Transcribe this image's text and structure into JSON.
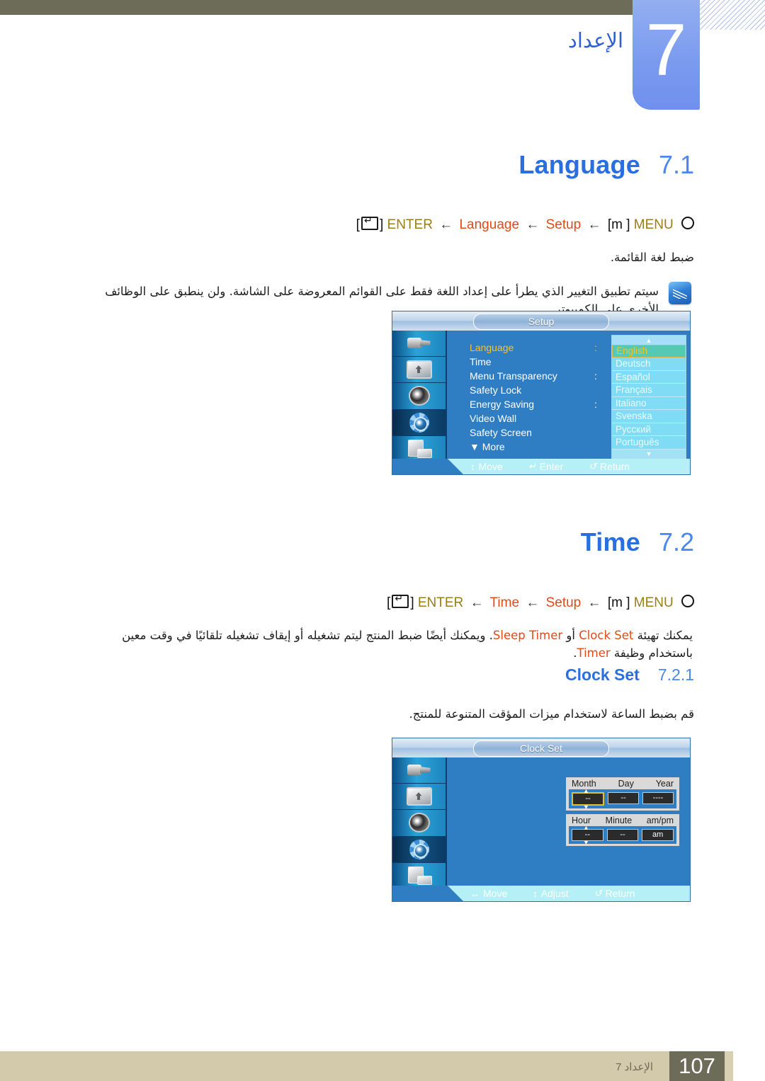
{
  "header": {
    "chapter_number": "7",
    "chapter_title": "الإعداد"
  },
  "sections": [
    {
      "title": "Language",
      "number": "7.1",
      "breadcrumb": {
        "enter_label": "ENTER",
        "item": "Language",
        "parent": "Setup",
        "menu_bracket": "[m  ]",
        "menu_label": "MENU",
        "arrow": "←"
      },
      "description_ar": "ضبط لغة القائمة.",
      "note_ar": "سيتم تطبيق التغيير الذي يطرأ على إعداد اللغة فقط على القوائم المعروضة على الشاشة. ولن ينطبق على الوظائف الأخرى على الكمبيوتر."
    },
    {
      "title": "Time",
      "number": "7.2",
      "breadcrumb": {
        "enter_label": "ENTER",
        "item": "Time",
        "parent": "Setup",
        "menu_bracket": "[m  ]",
        "menu_label": "MENU",
        "arrow": "←"
      },
      "description_ar_prefix": "يمكنك تهيئة ",
      "description_ar_middle": " أو ",
      "description_ar_rest": ". ويمكنك أيضًا ضبط المنتج ليتم تشغيله أو إيقاف تشغيله تلقائيًا في وقت معين باستخدام وظيفة ",
      "description_ar_suffix": ".",
      "red_term_1": "Clock Set",
      "red_term_2": "Sleep Timer",
      "red_term_3": "Timer"
    }
  ],
  "subsection": {
    "title": "Clock Set",
    "number": "7.2.1",
    "description_ar": "قم بضبط الساعة لاستخدام ميزات المؤقت المتنوعة للمنتج."
  },
  "osd_setup": {
    "title": "Setup",
    "sidebar_icons": [
      "input-plug-icon",
      "picture-icon",
      "sound-icon",
      "setup-gear-icon",
      "multi-control-icon"
    ],
    "selected_sidebar_index": 3,
    "menu_items": [
      {
        "label": "Language",
        "colon": ":",
        "active": true
      },
      {
        "label": "Time",
        "colon": "",
        "active": false
      },
      {
        "label": "Menu Transparency",
        "colon": ":",
        "active": false
      },
      {
        "label": "Safety Lock",
        "colon": "",
        "active": false
      },
      {
        "label": "Energy Saving",
        "colon": ":",
        "active": false
      },
      {
        "label": "Video Wall",
        "colon": "",
        "active": false
      },
      {
        "label": "Safety Screen",
        "colon": "",
        "active": false
      },
      {
        "label": "▼ More",
        "colon": "",
        "active": false
      }
    ],
    "language_options": [
      "English",
      "Deutsch",
      "Español",
      "Français",
      "Italiano",
      "Svenska",
      "Русский",
      "Português"
    ],
    "language_selected": "English",
    "scroll_up_glyph": "▲",
    "scroll_down_glyph": "▼",
    "hints": [
      {
        "glyph": "↕",
        "label": "Move"
      },
      {
        "glyph": "↵",
        "label": "Enter"
      },
      {
        "glyph": "↺",
        "label": "Return"
      }
    ]
  },
  "osd_clock": {
    "title": "Clock Set",
    "sidebar_icons": [
      "input-plug-icon",
      "picture-icon",
      "sound-icon",
      "setup-gear-icon",
      "multi-control-icon"
    ],
    "selected_sidebar_index": 3,
    "date_labels": [
      "Month",
      "Day",
      "Year"
    ],
    "date_values": [
      "--",
      "--",
      "----"
    ],
    "date_selected_index": 0,
    "time_labels": [
      "Hour",
      "Minute",
      "am/pm"
    ],
    "time_values": [
      "--",
      "--",
      "am"
    ],
    "hints": [
      {
        "glyph": "↔",
        "label": "Move"
      },
      {
        "glyph": "↕",
        "label": "Adjust"
      },
      {
        "glyph": "↺",
        "label": "Return"
      }
    ]
  },
  "footer": {
    "section_label": "الإعداد 7",
    "page_number": "107"
  },
  "colors": {
    "olive": "#6d6c59",
    "beige": "#d3c9ab",
    "heading_blue": "#2a6fe0",
    "accent_blue": "#4a87ee",
    "red_term": "#e04a17",
    "gold": "#9a7d18",
    "osd_blue": "#2f7ec4"
  }
}
